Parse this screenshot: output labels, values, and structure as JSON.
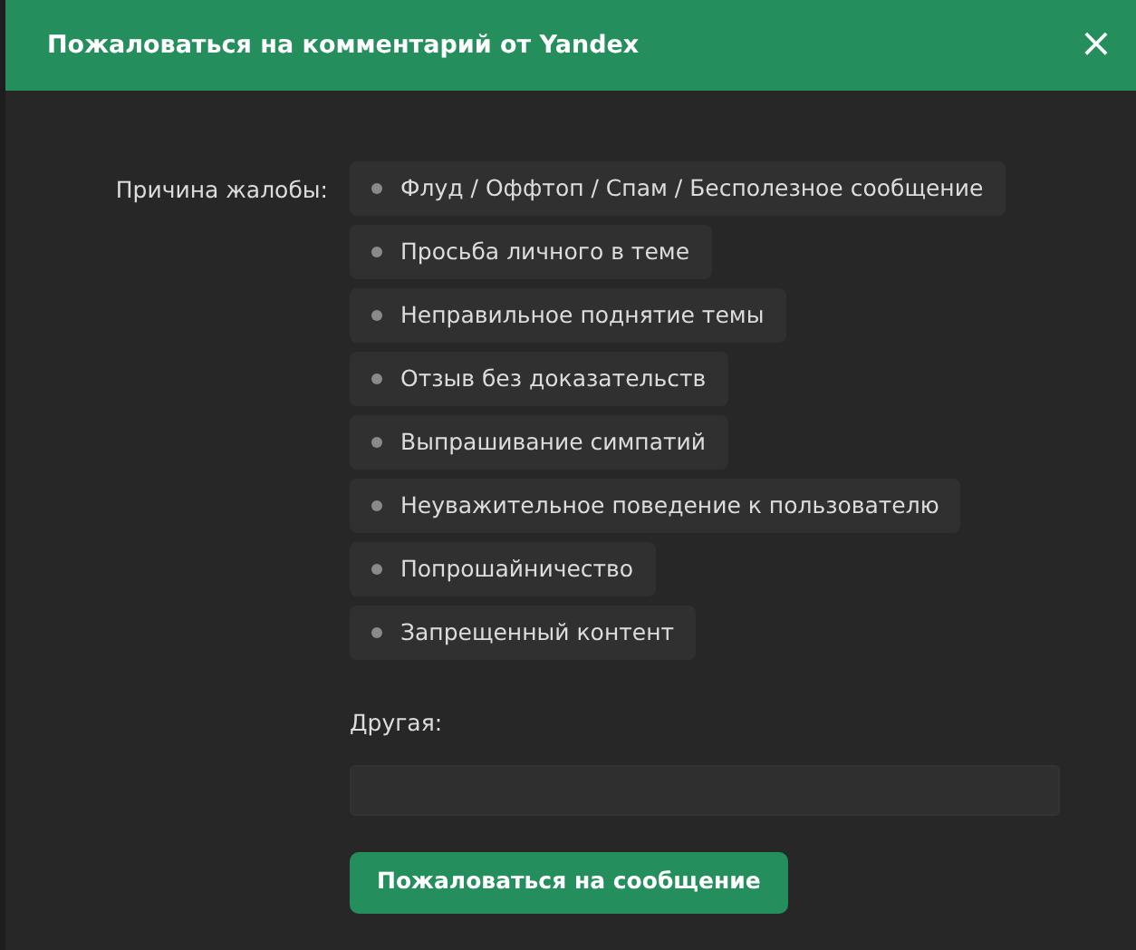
{
  "dialog": {
    "title": "Пожаловаться на комментарий от Yandex",
    "close": "×"
  },
  "reason_label": "Причина жалобы:",
  "reasons": [
    {
      "label": "Флуд / Оффтоп / Спам / Бесполезное сообщение",
      "selected": false
    },
    {
      "label": "Просьба личного в теме",
      "selected": false
    },
    {
      "label": "Неправильное поднятие темы",
      "selected": false
    },
    {
      "label": "Отзыв без доказательств",
      "selected": false
    },
    {
      "label": "Выпрашивание симпатий",
      "selected": false
    },
    {
      "label": "Неуважительное поведение к пользователю",
      "selected": false
    },
    {
      "label": "Попрошайничество",
      "selected": false
    },
    {
      "label": "Запрещенный контент",
      "selected": false
    }
  ],
  "other_label": "Другая:",
  "submit": "Пожаловаться на сообщение"
}
